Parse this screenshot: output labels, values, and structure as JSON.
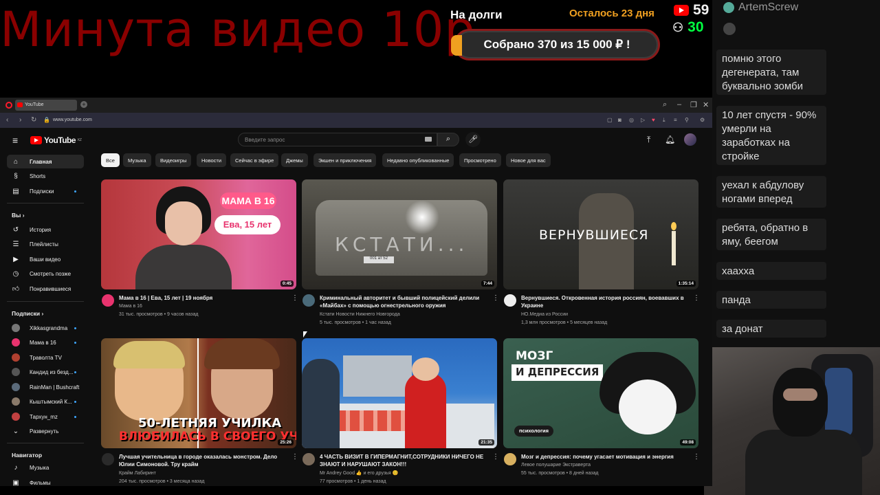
{
  "stream": {
    "overlay_title": "Минута видео 10р",
    "debt_label": "На долги",
    "days_left": "Осталось 23 дня",
    "collected": "Собрано 370  из 15 000 ₽ !",
    "youtube_viewers": "59",
    "twitch_viewers": "30"
  },
  "chat": {
    "user": "ArtemScrew",
    "messages": [
      "помню этого дегенерата, там буквально зомби",
      "10 лет спустя - 90% умерли на заработках на стройке",
      "уехал к абдулову ногами вперед",
      "ребята, обратно в яму, беегом",
      "хаахха",
      "панда",
      "за донат"
    ]
  },
  "browser": {
    "tab_title": "YouTube",
    "url": "www.youtube.com"
  },
  "youtube": {
    "logo": "YouTube",
    "logo_region": "KZ",
    "search_placeholder": "Введите запрос",
    "sidebar": {
      "main": [
        {
          "label": "Главная",
          "icon": "home-icon"
        },
        {
          "label": "Shorts",
          "icon": "shorts-icon"
        },
        {
          "label": "Подписки",
          "icon": "subscriptions-icon"
        }
      ],
      "you_header": "Вы",
      "you": [
        {
          "label": "История",
          "icon": "history-icon"
        },
        {
          "label": "Плейлисты",
          "icon": "playlist-icon"
        },
        {
          "label": "Ваши видео",
          "icon": "your-videos-icon"
        },
        {
          "label": "Смотреть позже",
          "icon": "watch-later-icon"
        },
        {
          "label": "Понравившиеся",
          "icon": "like-icon"
        }
      ],
      "subs_header": "Подписки",
      "subs": [
        {
          "label": "Xikkasgrandma",
          "color": "#777777"
        },
        {
          "label": "Мама в 16",
          "color": "#e8336e"
        },
        {
          "label": "Траволта TV",
          "color": "#b04030"
        },
        {
          "label": "Кандид из безд...",
          "color": "#555555"
        },
        {
          "label": "RainMan | Bushcraft",
          "color": "#5a6a7a"
        },
        {
          "label": "Кыштымский К...",
          "color": "#8a7a6a"
        },
        {
          "label": "Тархун_mz",
          "color": "#c04040"
        }
      ],
      "expand": "Развернуть",
      "nav_header": "Навигатор",
      "nav": [
        {
          "label": "Музыка",
          "icon": "music-icon"
        },
        {
          "label": "Фильмы",
          "icon": "movies-icon"
        }
      ]
    },
    "chips": [
      "Все",
      "Музыка",
      "Видеоигры",
      "Новости",
      "Сейчас в эфире",
      "Джемы",
      "Экшен и приключения",
      "Недавно опубликованные",
      "Просмотрено",
      "Новое для вас"
    ],
    "videos": [
      {
        "title": "Мама в 16 | Ева, 15 лет | 19 ноября",
        "channel": "Мама в 16",
        "meta": "31 тыс. просмотров • 9 часов назад",
        "duration": "0:45",
        "badge1": "МАМА В 16",
        "badge2": "Ева, 15 лет",
        "avatar_color": "#e8336e"
      },
      {
        "title": "Криминальный авторитет и бывший полицейский делили «Майбах» с помощью огнестрельного оружия",
        "channel": "Кстати Новости Нижнего Новгорода",
        "meta": "5 тыс. просмотров • 1 час назад",
        "duration": "7:44",
        "overlay": "КСТАТИ...",
        "plate": "001 ат 52",
        "avatar_color": "#4a6a7a"
      },
      {
        "title": "Вернувшиеся. Откровенная история россиян, воевавших в Украине",
        "channel": "НО.Медиа из России",
        "meta": "1,3 млн просмотров • 5 месяцев назад",
        "duration": "1:35:14",
        "overlay": "ВЕРНУВШИЕСЯ",
        "avatar_color": "#eeeeee"
      },
      {
        "title": "Лучшая учительница в городе оказалась монстром. Дело Юлии Симоновой. Тру крайм",
        "channel": "Крайм Лабиринт",
        "meta": "204 тыс. просмотров • 3 месяца назад",
        "duration": "25:26",
        "line1": "50-ЛЕТНЯЯ УЧИЛКА",
        "line2": "ВЛЮБИЛАСЬ В СВОЕГО УЧЕНИКА",
        "avatar_color": "#2a2a2a"
      },
      {
        "title": "4 ЧАСТЬ ВИЗИТ В ГИПЕРМАГНИТ,СОТРУДНИКИ НИЧЕГО НЕ ЗНАЮТ И НАРУШАЮТ ЗАКОН!!!",
        "channel": "Mr Andrey Good 👍 и его друзья 😊",
        "meta": "77 просмотров • 1 день назад",
        "duration": "21:35",
        "avatar_color": "#7a6a5a"
      },
      {
        "title": "Мозг и депрессия: почему угасает мотивация и энергия",
        "channel": "Левое полушарие Экстраверта",
        "meta": "55 тыс. просмотров • 8 дней назад",
        "duration": "49:08",
        "line1": "МОЗГ",
        "line2": "И ДЕПРЕССИЯ",
        "pill": "психология",
        "avatar_color": "#d8b060"
      }
    ]
  }
}
